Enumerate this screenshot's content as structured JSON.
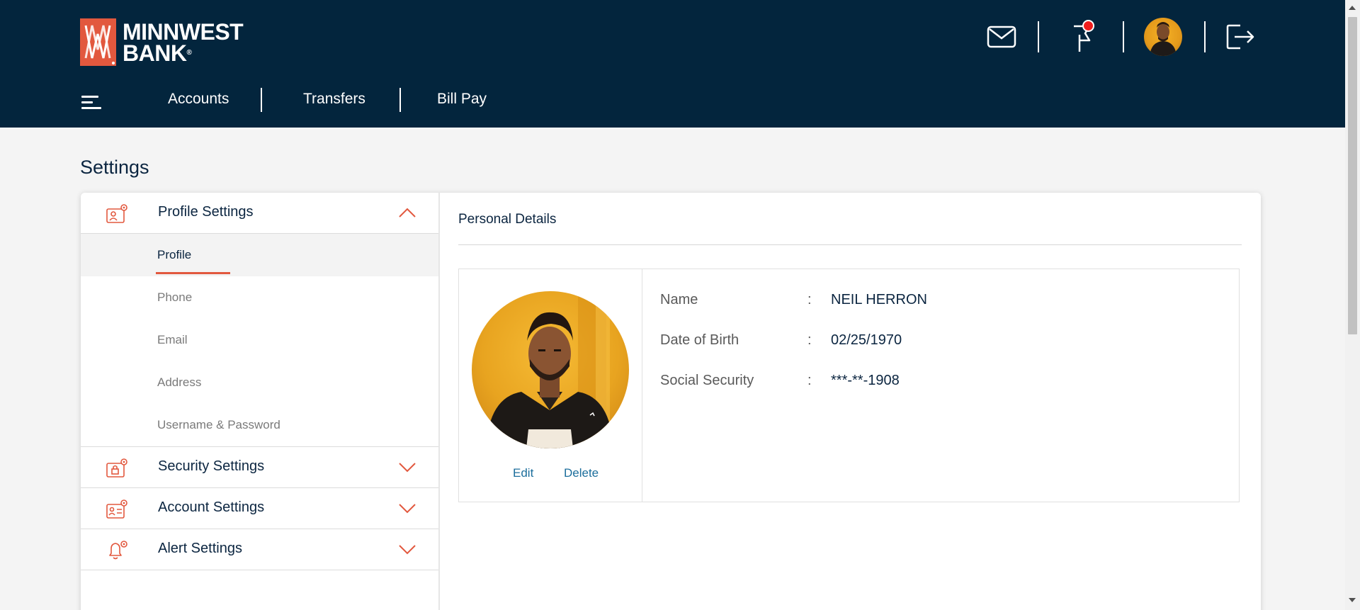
{
  "brand": {
    "line1": "MINNWEST",
    "line2": "BANK",
    "registered": "®",
    "colors": {
      "header_bg": "#03253d",
      "accent": "#e2583e",
      "link": "#1c6e9c"
    }
  },
  "header_icons": {
    "mail": "mail-icon",
    "flag": "flag-icon",
    "notification_dot": true,
    "avatar": "user-avatar",
    "logout": "logout-icon"
  },
  "nav": {
    "menu_icon": "hamburger-menu-icon",
    "items": [
      {
        "label": "Accounts"
      },
      {
        "label": "Transfers"
      },
      {
        "label": "Bill Pay"
      }
    ]
  },
  "page": {
    "title": "Settings"
  },
  "sidebar": {
    "sections": [
      {
        "label": "Profile Settings",
        "icon": "profile-settings-icon",
        "expanded": true,
        "items": [
          {
            "label": "Profile",
            "active": true
          },
          {
            "label": "Phone"
          },
          {
            "label": "Email"
          },
          {
            "label": "Address"
          },
          {
            "label": "Username & Password"
          }
        ]
      },
      {
        "label": "Security Settings",
        "icon": "security-settings-icon",
        "expanded": false
      },
      {
        "label": "Account Settings",
        "icon": "account-settings-icon",
        "expanded": false
      },
      {
        "label": "Alert Settings",
        "icon": "alert-settings-icon",
        "expanded": false
      }
    ]
  },
  "details": {
    "title": "Personal Details",
    "photo_actions": {
      "edit": "Edit",
      "delete": "Delete"
    },
    "separator": ":",
    "fields": [
      {
        "label": "Name",
        "value": "NEIL HERRON"
      },
      {
        "label": "Date of Birth",
        "value": "02/25/1970"
      },
      {
        "label": "Social Security",
        "value": "***-**-1908"
      }
    ]
  }
}
